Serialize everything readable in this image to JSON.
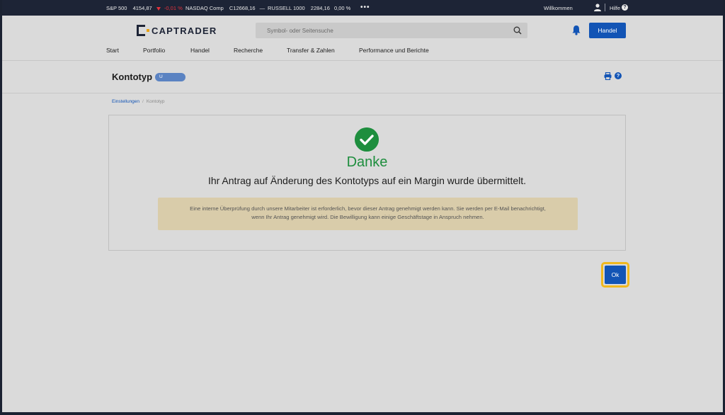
{
  "ticker": {
    "sp500": {
      "name": "S&P 500",
      "value": "4154,87",
      "change": "-0,01 %"
    },
    "nasdaq": {
      "name": "NASDAQ Comp",
      "value": "C12668,16",
      "change": "—"
    },
    "russell": {
      "name": "RUSSELL 1000",
      "value": "2284,16",
      "change": "0,00 %"
    },
    "more": "•••",
    "welcome": "Willkommen",
    "help": "Hilfe"
  },
  "header": {
    "logo_text": "CAPTRADER",
    "search_placeholder": "Symbol- oder Seitensuche",
    "trade_button": "Handel",
    "nav": [
      "Start",
      "Portfolio",
      "Handel",
      "Recherche",
      "Transfer & Zahlen",
      "Performance und Berichte"
    ]
  },
  "page": {
    "title": "Kontotyp",
    "badge": "U"
  },
  "breadcrumb": {
    "parent": "Einstellungen",
    "current": "Kontotyp"
  },
  "confirmation": {
    "heading": "Danke",
    "message": "Ihr Antrag auf Änderung des Kontotyps auf ein Margin wurde übermittelt.",
    "notice_line1": "Eine interne Überprüfung durch unsere Mitarbeiter ist erforderlich, bevor dieser Antrag genehmigt werden kann. Sie werden per E-Mail benachrichtigt,",
    "notice_line2": "wenn Ihr Antrag genehmigt wird. Die Bewilligung kann einige Geschäftstage in Anspruch nehmen."
  },
  "ok_button": "Ok",
  "colors": {
    "accent": "#1254b5",
    "success": "#1e8e3e",
    "down": "#e2323c",
    "focus_ring": "#f0b81e"
  }
}
